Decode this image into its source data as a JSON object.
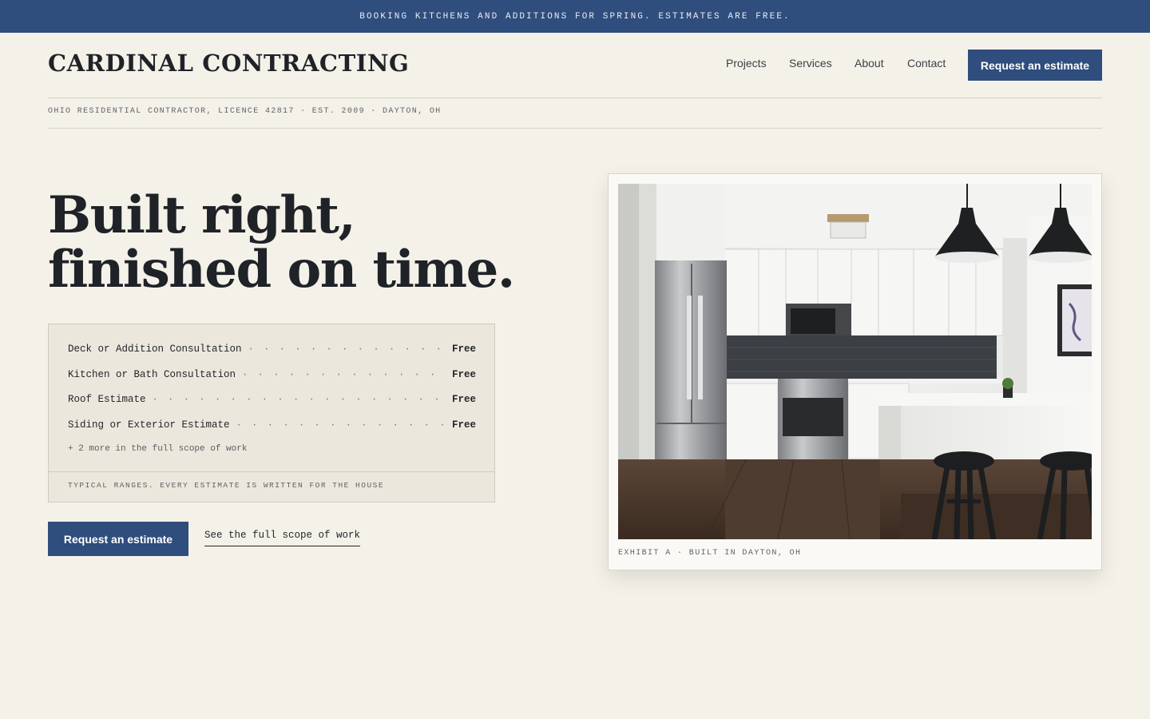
{
  "announcement": "BOOKING KITCHENS AND ADDITIONS FOR SPRING. ESTIMATES ARE FREE.",
  "brand": "CARDINAL CONTRACTING",
  "nav": {
    "items": [
      "Projects",
      "Services",
      "About",
      "Contact"
    ],
    "cta_label": "Request an estimate"
  },
  "licence_line": "OHIO RESIDENTIAL CONTRACTOR, LICENCE 42817 · EST. 2009 · DAYTON, OH",
  "hero": {
    "headline_line1": "Built right,",
    "headline_line2": "finished on time.",
    "cta_label": "Request an estimate",
    "scope_link": "See the full scope of work"
  },
  "price_list": {
    "rows": [
      {
        "label": "Deck or Addition Consultation",
        "price": "Free"
      },
      {
        "label": "Kitchen or Bath Consultation",
        "price": "Free"
      },
      {
        "label": "Roof Estimate",
        "price": "Free"
      },
      {
        "label": "Siding or Exterior Estimate",
        "price": "Free"
      }
    ],
    "more": "+ 2 more in the full scope of work",
    "note": "TYPICAL RANGES. EVERY ESTIMATE IS WRITTEN FOR THE HOUSE"
  },
  "exhibit": {
    "caption": "EXHIBIT A · BUILT IN DAYTON, OH"
  },
  "colors": {
    "background": "#f4f1e9",
    "accent_navy": "#2f4d7d",
    "ink": "#1f2328",
    "card": "#ebe7dc"
  },
  "icons": {
    "dot_leader": "dot-leader"
  }
}
